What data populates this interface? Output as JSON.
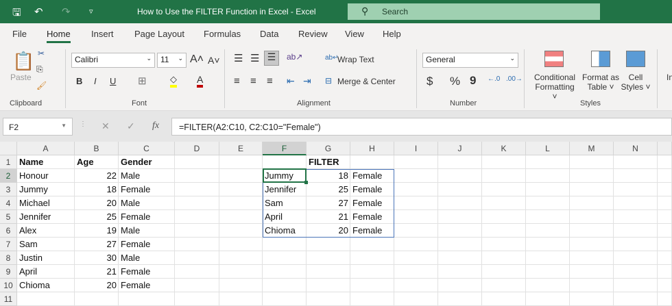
{
  "titlebar": {
    "title": "How to Use the FILTER Function in Excel  -  Excel",
    "search_placeholder": "Search"
  },
  "tabs": [
    "File",
    "Home",
    "Insert",
    "Page Layout",
    "Formulas",
    "Data",
    "Review",
    "View",
    "Help"
  ],
  "active_tab": "Home",
  "ribbon": {
    "clipboard": {
      "paste": "Paste",
      "label": "Clipboard"
    },
    "font": {
      "name": "Calibri",
      "size": "11",
      "label": "Font",
      "bold": "B",
      "italic": "I",
      "underline": "U",
      "highlight_color": "#ffff00",
      "font_color": "#c00000"
    },
    "alignment": {
      "wrap": "Wrap Text",
      "merge": "Merge & Center",
      "label": "Alignment"
    },
    "number": {
      "format": "General",
      "currency": "$",
      "percent": "%",
      "comma": "9",
      "label": "Number"
    },
    "styles": {
      "conditional": "Conditional",
      "conditional2": "Formatting",
      "format_as": "Format as",
      "format_as2": "Table",
      "cell": "Cell",
      "cell2": "Styles",
      "label": "Styles"
    },
    "insert_partial": "In"
  },
  "formula_bar": {
    "name_box": "F2",
    "fx": "fx",
    "formula": "=FILTER(A2:C10, C2:C10=\"Female\")"
  },
  "sheet": {
    "columns": [
      "A",
      "B",
      "C",
      "D",
      "E",
      "F",
      "G",
      "H",
      "I",
      "J",
      "K",
      "L",
      "M",
      "N"
    ],
    "rows": [
      "1",
      "2",
      "3",
      "4",
      "5",
      "6",
      "7",
      "8",
      "9",
      "10",
      "11"
    ],
    "selected_cell": "F2",
    "cells": [
      [
        "A1",
        "Name",
        "b"
      ],
      [
        "B1",
        "Age",
        "b"
      ],
      [
        "C1",
        "Gender",
        "b"
      ],
      [
        "G1",
        "FILTER",
        "b"
      ],
      [
        "A2",
        "Honour"
      ],
      [
        "B2",
        "22",
        "num"
      ],
      [
        "C2",
        "Male"
      ],
      [
        "A3",
        "Jummy"
      ],
      [
        "B3",
        "18",
        "num"
      ],
      [
        "C3",
        "Female"
      ],
      [
        "A4",
        "Michael"
      ],
      [
        "B4",
        "20",
        "num"
      ],
      [
        "C4",
        "Male"
      ],
      [
        "A5",
        "Jennifer"
      ],
      [
        "B5",
        "25",
        "num"
      ],
      [
        "C5",
        "Female"
      ],
      [
        "A6",
        "Alex"
      ],
      [
        "B6",
        "19",
        "num"
      ],
      [
        "C6",
        "Male"
      ],
      [
        "A7",
        "Sam"
      ],
      [
        "B7",
        "27",
        "num"
      ],
      [
        "C7",
        "Female"
      ],
      [
        "A8",
        "Justin"
      ],
      [
        "B8",
        "30",
        "num"
      ],
      [
        "C8",
        "Male"
      ],
      [
        "A9",
        "April"
      ],
      [
        "B9",
        "21",
        "num"
      ],
      [
        "C9",
        "Female"
      ],
      [
        "A10",
        "Chioma"
      ],
      [
        "B10",
        "20",
        "num"
      ],
      [
        "C10",
        "Female"
      ],
      [
        "F2",
        "Jummy"
      ],
      [
        "G2",
        "18",
        "num"
      ],
      [
        "H2",
        "Female"
      ],
      [
        "F3",
        "Jennifer"
      ],
      [
        "G3",
        "25",
        "num"
      ],
      [
        "H3",
        "Female"
      ],
      [
        "F4",
        "Sam"
      ],
      [
        "G4",
        "27",
        "num"
      ],
      [
        "H4",
        "Female"
      ],
      [
        "F5",
        "April"
      ],
      [
        "G5",
        "21",
        "num"
      ],
      [
        "H5",
        "Female"
      ],
      [
        "F6",
        "Chioma"
      ],
      [
        "G6",
        "20",
        "num"
      ],
      [
        "H6",
        "Female"
      ]
    ]
  }
}
